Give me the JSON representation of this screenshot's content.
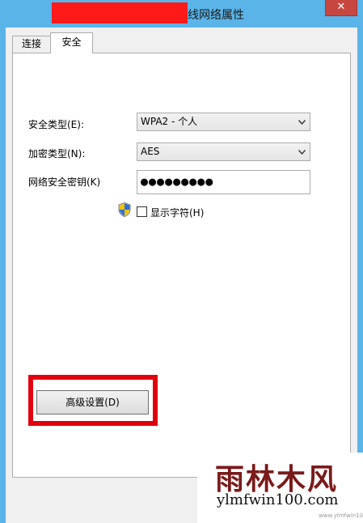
{
  "window": {
    "title": "线网络属性",
    "close_label": "✕"
  },
  "tabs": [
    {
      "label": "连接"
    },
    {
      "label": "安全"
    }
  ],
  "security": {
    "type_label": "安全类型(E):",
    "type_value": "WPA2 - 个人",
    "encryption_label": "加密类型(N):",
    "encryption_value": "AES",
    "key_label": "网络安全密钥(K)",
    "key_value": "●●●●●●●●●",
    "show_chars_label": "显示字符(H)"
  },
  "advanced_button_label": "高级设置(D)",
  "watermark": {
    "cn": "雨林木风",
    "url": "ylmfwin100.com",
    "small": "www.ylmfwin100.com"
  },
  "colors": {
    "title_bg": "#5ab4e8",
    "close_btn": "#c7463f",
    "redaction": "#ff1a1a",
    "highlight": "#e0000f"
  },
  "icons": {
    "close": "close-icon",
    "dropdown": "chevron-down-icon",
    "uac": "uac-shield-icon"
  }
}
